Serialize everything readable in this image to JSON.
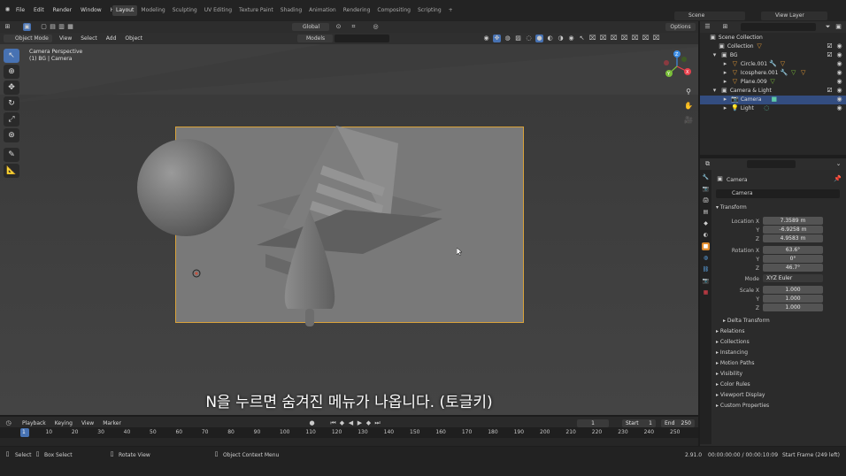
{
  "menu": [
    "File",
    "Edit",
    "Render",
    "Window",
    "Help"
  ],
  "workspaces": [
    "Layout",
    "Modeling",
    "Sculpting",
    "UV Editing",
    "Texture Paint",
    "Shading",
    "Animation",
    "Rendering",
    "Compositing",
    "Scripting",
    "+"
  ],
  "scene": {
    "label": "Scene"
  },
  "view_layer": {
    "label": "View Layer"
  },
  "viewport_header": {
    "mode": "Object Mode",
    "menus": [
      "View",
      "Select",
      "Add",
      "Object"
    ],
    "orientation": "Global",
    "options": "Options",
    "filter": "Models"
  },
  "viewport_info": {
    "line1": "Camera Perspective",
    "line2": "(1) BG | Camera"
  },
  "gizmo": {
    "x": "X",
    "y": "Y",
    "z": "Z"
  },
  "subtitle": "N을 누르면 숨겨진 메뉴가 나옵니다. (토글키)",
  "outliner": {
    "rows": [
      {
        "label": "Scene Collection",
        "indent": 0
      },
      {
        "label": "Collection",
        "indent": 1
      },
      {
        "label": "BG",
        "indent": 1
      },
      {
        "label": "Circle.001",
        "indent": 2
      },
      {
        "label": "Icosphere.001",
        "indent": 2
      },
      {
        "label": "Plane.009",
        "indent": 2
      },
      {
        "label": "Camera & Light",
        "indent": 1
      },
      {
        "label": "Camera",
        "indent": 2
      },
      {
        "label": "Light",
        "indent": 2
      }
    ]
  },
  "properties": {
    "object_name": "Camera",
    "data_name": "Camera",
    "transform_label": "Transform",
    "location": {
      "label": "Location X",
      "x": "7.3589 m",
      "y": "-6.9258 m",
      "z": "4.9583 m"
    },
    "rotation": {
      "label": "Rotation X",
      "x": "63.6°",
      "y": "0°",
      "z": "46.7°"
    },
    "mode": {
      "label": "Mode",
      "value": "XYZ Euler"
    },
    "scale": {
      "label": "Scale X",
      "x": "1.000",
      "y": "1.000",
      "z": "1.000"
    },
    "axis_y": "Y",
    "axis_z": "Z",
    "delta": "Delta Transform",
    "panels": [
      "Relations",
      "Collections",
      "Instancing",
      "Motion Paths",
      "Visibility",
      "Color Rules",
      "Viewport Display",
      "Custom Properties"
    ]
  },
  "timeline": {
    "menus": [
      "Playback",
      "Keying",
      "View",
      "Marker"
    ],
    "current": "1",
    "start_label": "Start",
    "start": "1",
    "end_label": "End",
    "end": "250",
    "ticks": [
      "1",
      "10",
      "20",
      "30",
      "40",
      "50",
      "60",
      "70",
      "80",
      "90",
      "100",
      "110",
      "120",
      "130",
      "140",
      "150",
      "160",
      "170",
      "180",
      "190",
      "200",
      "210",
      "220",
      "230",
      "240",
      "250"
    ]
  },
  "status": {
    "select": "Select",
    "box": "Box Select",
    "rotate": "Rotate View",
    "ctx": "Object Context Menu",
    "version": "2.91.0",
    "time": "00:00:00:00 / 00:00:10:09",
    "frames": "Start Frame (249 left)"
  },
  "colors": {
    "accent": "#4772b3",
    "selected_row": "#334d80",
    "camera_frame": "#d9a23a",
    "x_axis": "#e8414d",
    "y_axis": "#7bbf3a",
    "z_axis": "#3d8ee6"
  }
}
